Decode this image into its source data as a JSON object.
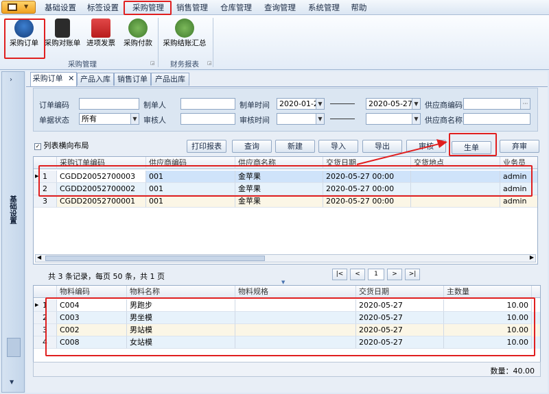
{
  "menu": [
    "基础设置",
    "标签设置",
    "采购管理",
    "销售管理",
    "仓库管理",
    "查询管理",
    "系统管理",
    "帮助"
  ],
  "ribbon": {
    "groups": [
      {
        "label": "采购管理",
        "buttons": [
          "采购订单",
          "采购对账单",
          "进项发票",
          "采购付款"
        ]
      },
      {
        "label": "财务报表",
        "buttons": [
          "采购结账汇总"
        ]
      }
    ]
  },
  "left_pane_label": "基础设置",
  "tabs": [
    "采购订单",
    "产品入库",
    "销售订单",
    "产品出库"
  ],
  "filter": {
    "order_no_label": "订单编码",
    "maker_label": "制单人",
    "make_time_label": "制单时间",
    "date_from": "2020-01-2(",
    "date_to": "2020-05-27",
    "supplier_code_label": "供应商编码",
    "status_label": "单据状态",
    "status_value": "所有",
    "auditor_label": "审核人",
    "audit_time_label": "审核时间",
    "supplier_name_label": "供应商名称",
    "ellipsis": "···"
  },
  "layout_checkbox": "列表横向布局",
  "toolbar": [
    "打印报表",
    "查询",
    "新建",
    "导入",
    "导出",
    "审核",
    "生单",
    "弃审"
  ],
  "order_grid": {
    "columns": [
      "采购订单编码",
      "供应商编码",
      "供应商名称",
      "交货日期",
      "交货地点",
      "业务员"
    ],
    "rows": [
      {
        "n": "1",
        "code": "CGDD20052700003",
        "sup": "001",
        "name": "金苹果",
        "date": "2020-05-27 00:00",
        "place": "",
        "sales": "admin"
      },
      {
        "n": "2",
        "code": "CGDD20052700002",
        "sup": "001",
        "name": "金苹果",
        "date": "2020-05-27 00:00",
        "place": "",
        "sales": "admin"
      },
      {
        "n": "3",
        "code": "CGDD20052700001",
        "sup": "001",
        "name": "金苹果",
        "date": "2020-05-27 00:00",
        "place": "",
        "sales": "admin"
      }
    ]
  },
  "pager": {
    "info": "共 3 条记录，每页 50 条，共 1 页",
    "first": "|<",
    "prev": "<",
    "page": "1",
    "next": ">",
    "last": ">|"
  },
  "detail_grid": {
    "columns": [
      "物料编码",
      "物料名称",
      "物料规格",
      "交货日期",
      "主数量"
    ],
    "rows": [
      {
        "n": "1",
        "code": "C004",
        "name": "男跑步",
        "spec": "",
        "date": "2020-05-27",
        "qty": "10.00"
      },
      {
        "n": "2",
        "code": "C003",
        "name": "男坐模",
        "spec": "",
        "date": "2020-05-27",
        "qty": "10.00"
      },
      {
        "n": "3",
        "code": "C002",
        "name": "男站模",
        "spec": "",
        "date": "2020-05-27",
        "qty": "10.00"
      },
      {
        "n": "4",
        "code": "C008",
        "name": "女站模",
        "spec": "",
        "date": "2020-05-27",
        "qty": "10.00"
      }
    ]
  },
  "summary": "数量：40.00"
}
